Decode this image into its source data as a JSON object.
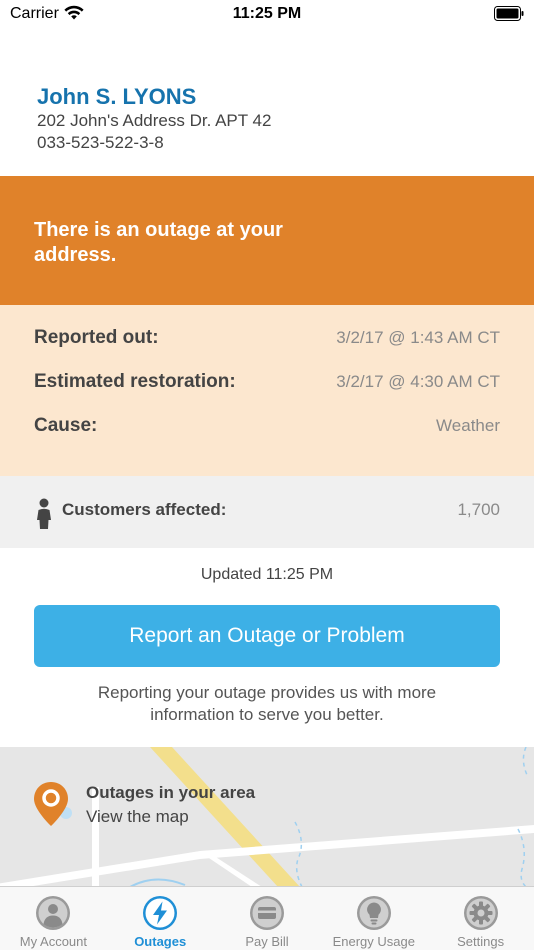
{
  "status_bar": {
    "carrier": "Carrier",
    "time": "11:25 PM"
  },
  "account": {
    "name": "John S. LYONS",
    "address": "202 John's Address Dr. APT 42",
    "number": "033-523-522-3-8"
  },
  "outage_banner": {
    "message": "There is an outage at your address."
  },
  "details": {
    "reported_label": "Reported out:",
    "reported_value": "3/2/17 @ 1:43 AM CT",
    "restoration_label": "Estimated restoration:",
    "restoration_value": "3/2/17 @ 4:30 AM CT",
    "cause_label": "Cause:",
    "cause_value": "Weather"
  },
  "customers": {
    "label": "Customers affected:",
    "value": "1,700"
  },
  "updated": "Updated 11:25 PM",
  "report_button": "Report an Outage or Problem",
  "report_note": "Reporting your outage provides us with more information to serve you better.",
  "map": {
    "title": "Outages in your area",
    "link": "View the map"
  },
  "tabs": [
    {
      "label": "My Account",
      "icon": "person-icon"
    },
    {
      "label": "Outages",
      "icon": "lightning-icon"
    },
    {
      "label": "Pay Bill",
      "icon": "credit-card-icon"
    },
    {
      "label": "Energy Usage",
      "icon": "lightbulb-icon"
    },
    {
      "label": "Settings",
      "icon": "gear-icon"
    }
  ],
  "colors": {
    "brand_blue": "#1673ad",
    "outage_orange": "#e0822a",
    "details_bg": "#fce7cf",
    "button_blue": "#3db0e6",
    "active_tab": "#1f8fd6",
    "inactive_tab": "#8a8a8a"
  }
}
